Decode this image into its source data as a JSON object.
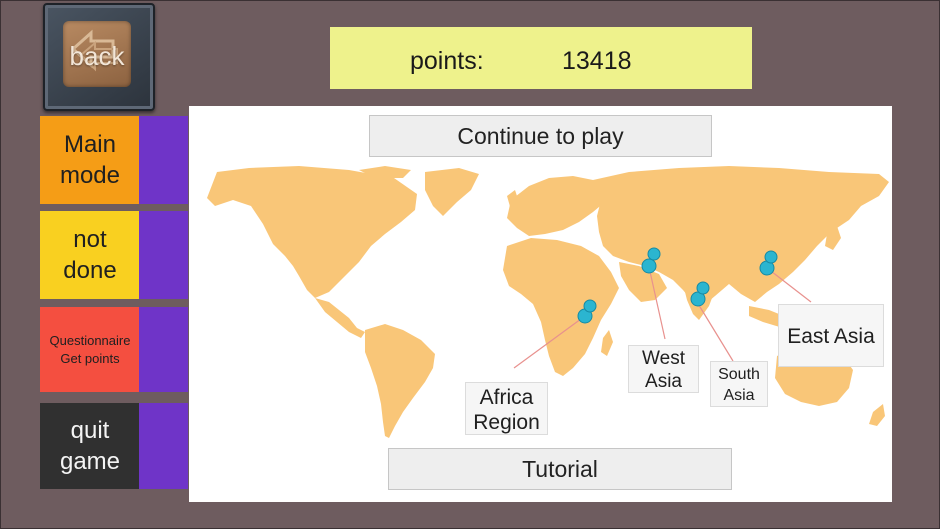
{
  "back_button": {
    "label": "back"
  },
  "points": {
    "label": "points:",
    "value": "13418"
  },
  "menu": {
    "main_mode": {
      "line1": "Main",
      "line2": "mode"
    },
    "not_done": {
      "line1": "not",
      "line2": "done"
    },
    "questionnaire": {
      "line1": "Questionnaire",
      "line2": "Get points"
    },
    "quit_game": {
      "line1": "quit",
      "line2": "game"
    }
  },
  "map": {
    "continue_button": "Continue to play",
    "tutorial_button": "Tutorial",
    "regions": {
      "africa": {
        "line1": "Africa",
        "line2": "Region"
      },
      "west_asia": {
        "line1": "West",
        "line2": "Asia"
      },
      "south_asia": {
        "line1": "South",
        "line2": "Asia"
      },
      "east_asia": {
        "line1": "East Asia"
      }
    }
  },
  "colors": {
    "background": "#6e5c5f",
    "points_bg": "#eef28c",
    "land": "#f9c678",
    "pin": "#2bb5d0",
    "tab_purple": "#6f34c8",
    "main_mode": "#f59d16",
    "not_done": "#f9d020",
    "questionnaire": "#f44f40",
    "quit_game": "#303030"
  }
}
